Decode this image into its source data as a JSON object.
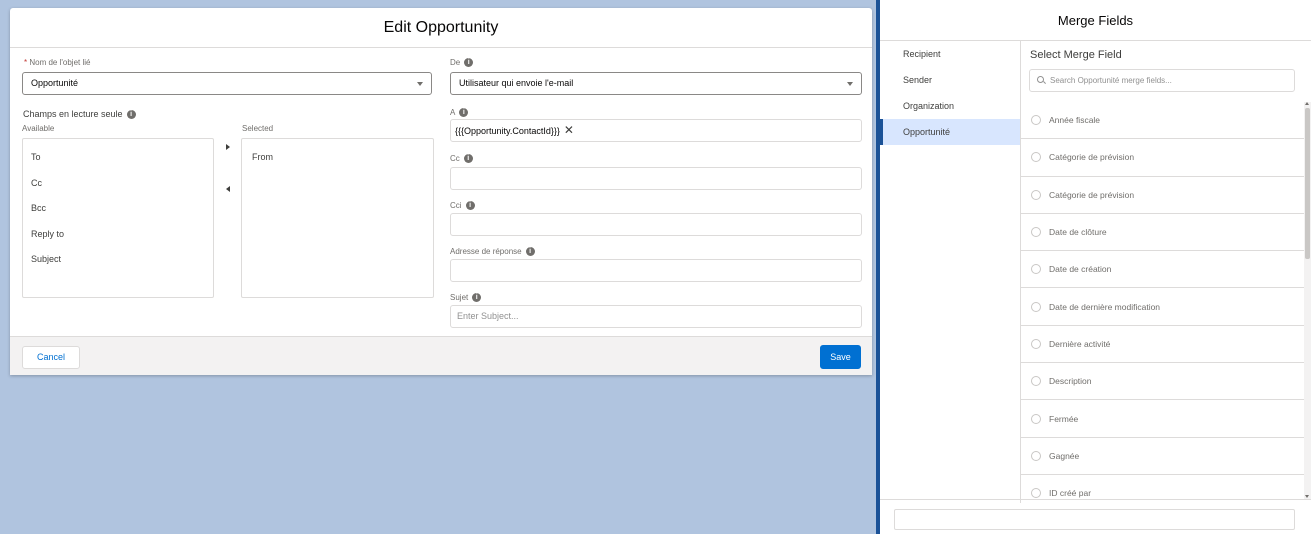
{
  "modal": {
    "title": "Edit Opportunity",
    "related_object": {
      "required_mark": "*",
      "label": "Nom de l'objet lié",
      "value": "Opportunité"
    },
    "readonly_fields": {
      "label": "Champs en lecture seule",
      "available_label": "Available",
      "selected_label": "Selected",
      "available": [
        "To",
        "Cc",
        "Bcc",
        "Reply to",
        "Subject"
      ],
      "selected": [
        "From"
      ]
    },
    "from": {
      "label": "De",
      "value": "Utilisateur qui envoie l'e-mail"
    },
    "to": {
      "label": "A",
      "value": "{{{Opportunity.ContactId}}}"
    },
    "cc": {
      "label": "Cc",
      "value": ""
    },
    "bcc": {
      "label": "Cci",
      "value": ""
    },
    "reply_to": {
      "label": "Adresse de réponse",
      "value": ""
    },
    "subject": {
      "label": "Sujet",
      "placeholder": "Enter Subject..."
    },
    "footer": {
      "cancel_label": "Cancel",
      "save_label": "Save"
    }
  },
  "merge_panel": {
    "title": "Merge Fields",
    "tabs": [
      {
        "label": "Recipient",
        "active": false
      },
      {
        "label": "Sender",
        "active": false
      },
      {
        "label": "Organization",
        "active": false
      },
      {
        "label": "Opportunité",
        "active": true
      }
    ],
    "heading": "Select Merge Field",
    "search_placeholder": "Search Opportunité merge fields...",
    "fields": [
      "Année fiscale",
      "Catégorie de prévision",
      "Catégorie de prévision",
      "Date de clôture",
      "Date de création",
      "Date de dernière modification",
      "Dernière activité",
      "Description",
      "Fermée",
      "Gagnée",
      "ID créé par"
    ]
  }
}
